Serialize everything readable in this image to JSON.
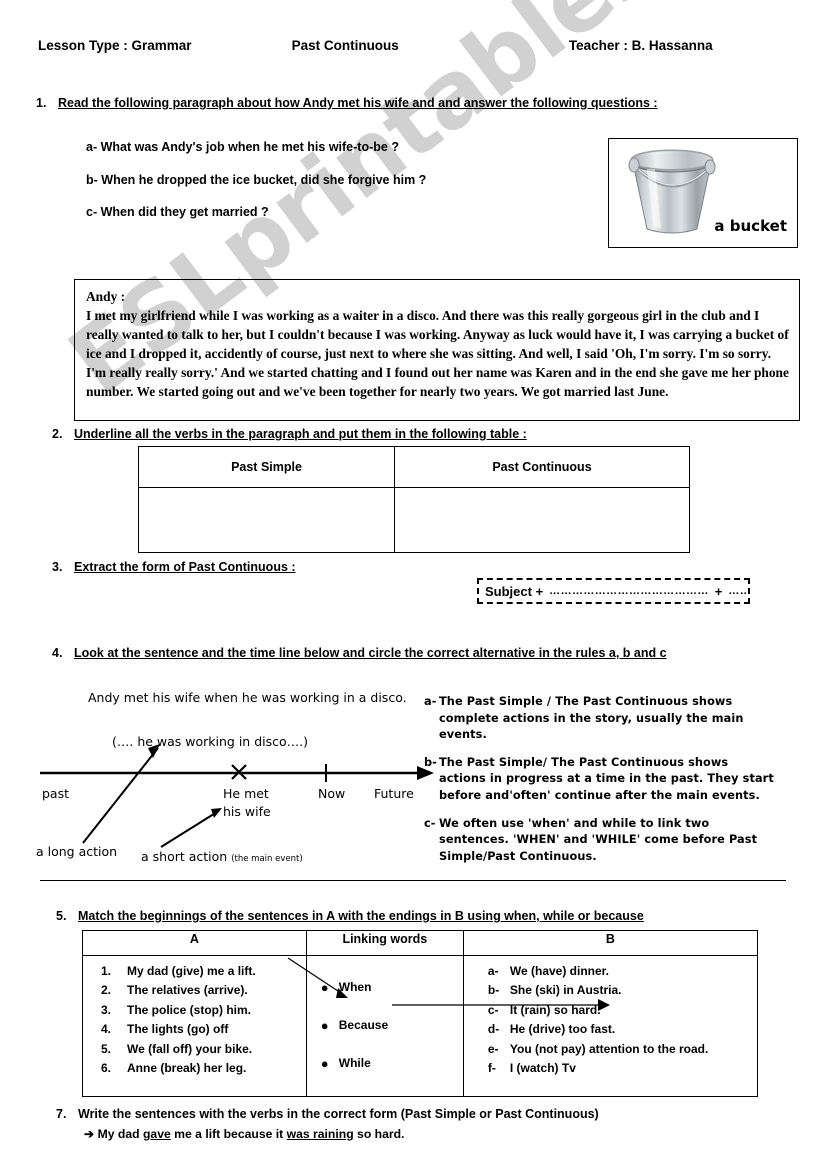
{
  "header": {
    "lesson_type": "Lesson Type : Grammar",
    "topic": "Past Continuous",
    "teacher": "Teacher : B. Hassanna"
  },
  "task1": {
    "number": "1.",
    "instruction": "Read the following paragraph about how Andy met his wife and and answer the following questions :",
    "questions": [
      "a-  What was Andy's job when he met his wife-to-be ?",
      "b-  When he dropped the ice bucket, did she forgive him ?",
      "c-  When did they get married ?"
    ]
  },
  "picture": {
    "caption": "a bucket",
    "icon": "bucket-image"
  },
  "story": {
    "speaker": "Andy :",
    "text": "I met my girlfriend while I was working as a waiter in a disco. And there was this really gorgeous girl in the club and I really wanted to talk to her, but I couldn't because I was working. Anyway as luck would have it, I was carrying a bucket of ice and I dropped it, accidently of course, just next to where she was sitting. And well, I said 'Oh, I'm sorry. I'm so sorry. I'm really really sorry.' And we started chatting and I found out her name was Karen and in the end she gave me her phone number. We started going out and we've been together for nearly two years. We got married last June."
  },
  "task2": {
    "number": "2.",
    "instruction": "Underline all the verbs in the paragraph and put them in the following table :",
    "table": {
      "headers": [
        "Past Simple",
        "Past Continuous"
      ],
      "rows": [
        [
          "",
          ""
        ]
      ]
    }
  },
  "task3": {
    "number": "3.",
    "instruction": "Extract the form of Past Continuous :",
    "formula_label": "Subject +",
    "blank1": "……………………………………",
    "plus": "+",
    "blank2": "…………………………………………"
  },
  "task4": {
    "number": "4.",
    "instruction": "Look at the sentence and the time line below and circle the correct alternative in the rules a, b and c",
    "example_sentence": "Andy met his wife when he was working in a disco.",
    "timeline": {
      "long_action_bracket": "(…. he was working in disco….)",
      "past_label": "past",
      "event_line1": "He met",
      "event_line2": "his wife",
      "now_label": "Now",
      "future_label": "Future",
      "long_action_label": "a long action",
      "short_action_label": "a short action",
      "short_action_note": "(the main event)",
      "event_marker": "x"
    },
    "rules": [
      {
        "label": "a-",
        "text": "The Past Simple / The Past Continuous shows complete actions in the story, usually the main events."
      },
      {
        "label": "b-",
        "text": "The Past Simple/ The Past Continuous shows actions in progress at a time in the past. They start before and'often' continue after the main events."
      },
      {
        "label": "c-",
        "text": "We often use 'when' and while to link two sentences.  'WHEN' and 'WHILE' come before Past Simple/Past Continuous."
      }
    ]
  },
  "task5": {
    "number": "5.",
    "instruction": "Match the beginnings of the sentences in A with the endings in B using when, while or because",
    "headers": [
      "A",
      "Linking words",
      "B"
    ],
    "column_a": [
      {
        "mark": "1.",
        "text": "My dad (give) me a lift."
      },
      {
        "mark": "2.",
        "text": "The relatives (arrive)."
      },
      {
        "mark": "3.",
        "text": "The police (stop) him."
      },
      {
        "mark": "4.",
        "text": "The lights (go) off"
      },
      {
        "mark": "5.",
        "text": "We (fall off) your bike."
      },
      {
        "mark": "6.",
        "text": "Anne (break) her leg."
      }
    ],
    "linking_words": [
      "When",
      "Because",
      "While"
    ],
    "column_b": [
      {
        "mark": "a-",
        "text": "We (have) dinner."
      },
      {
        "mark": "b-",
        "text": "She (ski) in Austria."
      },
      {
        "mark": "c-",
        "text": "It (rain) so hard."
      },
      {
        "mark": "d-",
        "text": "He (drive) too fast."
      },
      {
        "mark": "e-",
        "text": "You (not pay) attention to the road."
      },
      {
        "mark": "f-",
        "text": "I (watch) Tv"
      }
    ]
  },
  "task7": {
    "number": "7.",
    "instruction": "Write the sentences with the verbs in the correct form (Past Simple or Past Continuous)",
    "arrow": "➔",
    "answer_pre": "My dad ",
    "answer_u1": "gave",
    "answer_mid": " me a lift because it ",
    "answer_u2": "was raining",
    "answer_post": " so hard."
  },
  "watermark": {
    "text": "ESLprintables.com"
  }
}
